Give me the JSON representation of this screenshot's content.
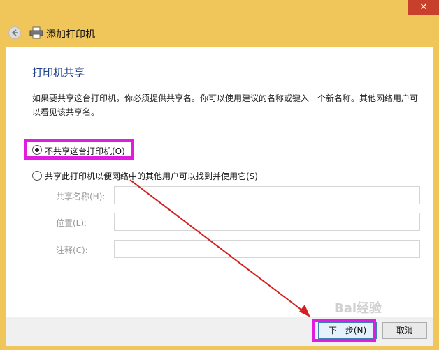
{
  "window": {
    "close_glyph": "✕",
    "title": "添加打印机"
  },
  "page": {
    "heading": "打印机共享",
    "description": "如果要共享这台打印机，你必须提供共享名。你可以使用建议的名称或键入一个新名称。其他网络用户可以看见该共享名。"
  },
  "sharing": {
    "option_no_share": {
      "label": "不共享这台打印机(O)",
      "selected": true
    },
    "option_share": {
      "label": "共享此打印机以便网络中的其他用户可以找到并使用它(S)",
      "selected": false
    },
    "fields": [
      {
        "label": "共享名称(H):",
        "value": ""
      },
      {
        "label": "位置(L):",
        "value": ""
      },
      {
        "label": "注释(C):",
        "value": ""
      }
    ]
  },
  "buttons": {
    "next": "下一步(N)",
    "cancel": "取消"
  },
  "annotations": {
    "highlight_color": "#e21be0",
    "arrow_color": "#d42020"
  },
  "watermark": "Bai经验"
}
